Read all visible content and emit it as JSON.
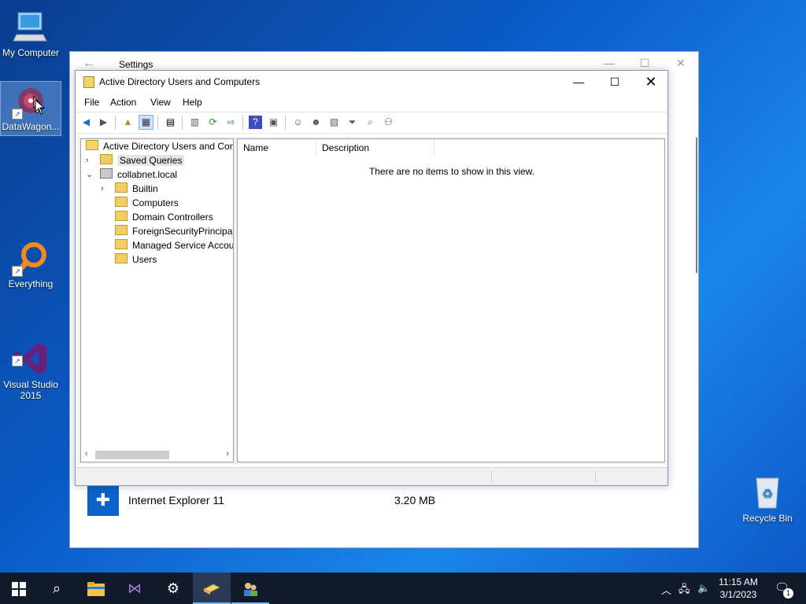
{
  "desktop": {
    "icons": [
      {
        "label": "My Computer"
      },
      {
        "label": "DataWagon..."
      },
      {
        "label": "Everything"
      },
      {
        "label": "Visual Studio\n2015"
      },
      {
        "label": "Recycle Bin"
      }
    ]
  },
  "settings_window": {
    "title": "Settings",
    "app_row": {
      "name": "Internet Explorer 11",
      "size": "3.20 MB"
    }
  },
  "aduc": {
    "title": "Active Directory Users and Computers",
    "menu": [
      "File",
      "Action",
      "View",
      "Help"
    ],
    "tree": {
      "root": "Active Directory Users and Com",
      "saved_queries": "Saved Queries",
      "domain": "collabnet.local",
      "children": [
        "Builtin",
        "Computers",
        "Domain Controllers",
        "ForeignSecurityPrincipals",
        "Managed Service Accour",
        "Users"
      ]
    },
    "columns": [
      "Name",
      "Description"
    ],
    "empty_message": "There are no items to show in this view."
  },
  "taskbar": {
    "time": "11:15 AM",
    "date": "3/1/2023",
    "notification_count": "1"
  },
  "colors": {
    "accent": "#0a63c9",
    "taskbar": "#101a2b"
  }
}
